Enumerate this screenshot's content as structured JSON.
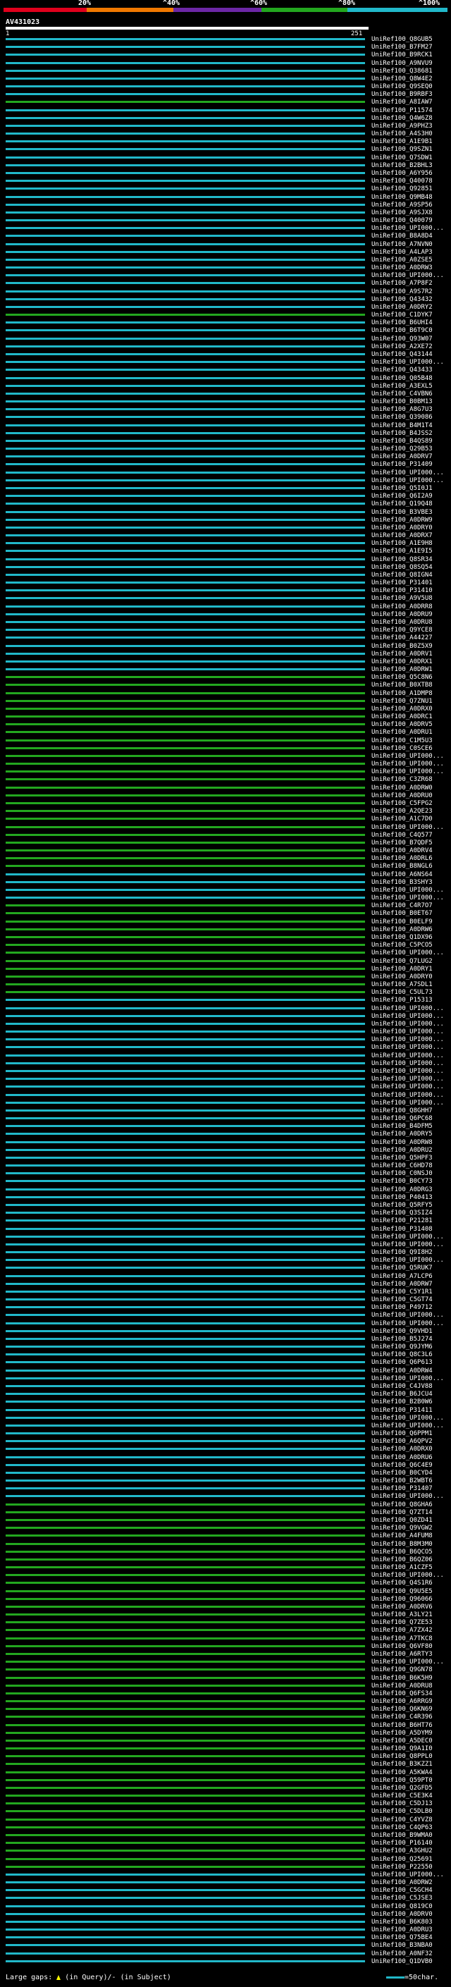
{
  "colors": {
    "background": "#000000",
    "query": "#ffffff",
    "band_0_20": "#e0001c",
    "band_20_40": "#f07800",
    "band_40_60": "#6c27a6",
    "band_60_80": "#23a71f",
    "band_80_100": "#21b8c9",
    "gap_marker": "#ffff00"
  },
  "scale": {
    "labels": [
      "20%",
      "^40%",
      "^60%",
      "^80%",
      "^100%"
    ]
  },
  "query": {
    "name": "AV431023",
    "start": "1",
    "end": "251"
  },
  "footer": {
    "gaps_label": "Large gaps:",
    "in_query": "(in Query)/",
    "in_subject": "- (in Subject)",
    "scale_note": "=50char."
  },
  "hits": [
    {
      "label": "UniRef100_Q8GUB5",
      "color": "cyan"
    },
    {
      "label": "UniRef100_B7FM27",
      "color": "cyan"
    },
    {
      "label": "UniRef100_B9RCK1",
      "color": "cyan"
    },
    {
      "label": "UniRef100_A9NVU9",
      "color": "cyan"
    },
    {
      "label": "UniRef100_Q38681",
      "color": "cyan"
    },
    {
      "label": "UniRef100_Q8W4E2",
      "color": "cyan"
    },
    {
      "label": "UniRef100_Q9SEQ0",
      "color": "cyan"
    },
    {
      "label": "UniRef100_B9RBF3",
      "color": "cyan"
    },
    {
      "label": "UniRef100_A8IAW7",
      "color": "green"
    },
    {
      "label": "UniRef100_P11574",
      "color": "cyan"
    },
    {
      "label": "UniRef100_Q4W6Z8",
      "color": "cyan"
    },
    {
      "label": "UniRef100_A9PHZ3",
      "color": "cyan"
    },
    {
      "label": "UniRef100_A4S3H0",
      "color": "cyan"
    },
    {
      "label": "UniRef100_A1E9B1",
      "color": "cyan"
    },
    {
      "label": "UniRef100_Q9SZN1",
      "color": "cyan"
    },
    {
      "label": "UniRef100_Q7SDW1",
      "color": "cyan"
    },
    {
      "label": "UniRef100_B2BHL3",
      "color": "cyan"
    },
    {
      "label": "UniRef100_A6Y956",
      "color": "cyan"
    },
    {
      "label": "UniRef100_Q40078",
      "color": "cyan"
    },
    {
      "label": "UniRef100_Q92851",
      "color": "cyan"
    },
    {
      "label": "UniRef100_Q9MB48",
      "color": "cyan"
    },
    {
      "label": "UniRef100_A9SP56",
      "color": "cyan"
    },
    {
      "label": "UniRef100_A9SJX8",
      "color": "cyan"
    },
    {
      "label": "UniRef100_Q40079",
      "color": "cyan"
    },
    {
      "label": "UniRef100_UPI000...",
      "color": "cyan"
    },
    {
      "label": "UniRef100_B8A8D4",
      "color": "cyan"
    },
    {
      "label": "UniRef100_A7NVN0",
      "color": "cyan"
    },
    {
      "label": "UniRef100_A4LAP3",
      "color": "cyan"
    },
    {
      "label": "UniRef100_A0ZSE5",
      "color": "cyan"
    },
    {
      "label": "UniRef100_A0DRW3",
      "color": "cyan"
    },
    {
      "label": "UniRef100_UPI000...",
      "color": "cyan"
    },
    {
      "label": "UniRef100_A7P8F2",
      "color": "cyan"
    },
    {
      "label": "UniRef100_A9S7R2",
      "color": "cyan"
    },
    {
      "label": "UniRef100_Q43432",
      "color": "cyan"
    },
    {
      "label": "UniRef100_A0DRY2",
      "color": "cyan"
    },
    {
      "label": "UniRef100_C1DYK7",
      "color": "green"
    },
    {
      "label": "UniRef100_B6UHI4",
      "color": "cyan"
    },
    {
      "label": "UniRef100_B6T9C0",
      "color": "cyan"
    },
    {
      "label": "UniRef100_Q93W07",
      "color": "cyan"
    },
    {
      "label": "UniRef100_A2XE72",
      "color": "cyan"
    },
    {
      "label": "UniRef100_Q43144",
      "color": "cyan"
    },
    {
      "label": "UniRef100_UPI000...",
      "color": "cyan"
    },
    {
      "label": "UniRef100_Q43433",
      "color": "cyan"
    },
    {
      "label": "UniRef100_Q05B48",
      "color": "cyan"
    },
    {
      "label": "UniRef100_A3EXL5",
      "color": "cyan"
    },
    {
      "label": "UniRef100_C4VBN6",
      "color": "cyan"
    },
    {
      "label": "UniRef100_B0BM13",
      "color": "cyan"
    },
    {
      "label": "UniRef100_A8G7U3",
      "color": "cyan"
    },
    {
      "label": "UniRef100_Q39086",
      "color": "cyan"
    },
    {
      "label": "UniRef100_B4M1T4",
      "color": "cyan"
    },
    {
      "label": "UniRef100_B4JSS2",
      "color": "cyan"
    },
    {
      "label": "UniRef100_B4QS89",
      "color": "cyan"
    },
    {
      "label": "UniRef100_Q29B53",
      "color": "cyan"
    },
    {
      "label": "UniRef100_A0DRV7",
      "color": "cyan"
    },
    {
      "label": "UniRef100_P31409",
      "color": "cyan"
    },
    {
      "label": "UniRef100_UPI000...",
      "color": "cyan"
    },
    {
      "label": "UniRef100_UPI000...",
      "color": "cyan"
    },
    {
      "label": "UniRef100_Q5I0J1",
      "color": "cyan"
    },
    {
      "label": "UniRef100_Q6I2A9",
      "color": "cyan"
    },
    {
      "label": "UniRef100_Q19Q48",
      "color": "cyan"
    },
    {
      "label": "UniRef100_B3VBE3",
      "color": "cyan"
    },
    {
      "label": "UniRef100_A0DRW9",
      "color": "cyan"
    },
    {
      "label": "UniRef100_A0DRY0",
      "color": "cyan"
    },
    {
      "label": "UniRef100_A0DRX7",
      "color": "cyan"
    },
    {
      "label": "UniRef100_A1E9H8",
      "color": "cyan"
    },
    {
      "label": "UniRef100_A1E9I5",
      "color": "cyan"
    },
    {
      "label": "UniRef100_Q8SR34",
      "color": "cyan"
    },
    {
      "label": "UniRef100_Q8SQ54",
      "color": "cyan"
    },
    {
      "label": "UniRef100_Q8IGN4",
      "color": "cyan"
    },
    {
      "label": "UniRef100_P31401",
      "color": "cyan"
    },
    {
      "label": "UniRef100_P31410",
      "color": "cyan"
    },
    {
      "label": "UniRef100_A9V5U8",
      "color": "cyan"
    },
    {
      "label": "UniRef100_A0DRR8",
      "color": "cyan"
    },
    {
      "label": "UniRef100_A0DRU9",
      "color": "cyan"
    },
    {
      "label": "UniRef100_A0DRU8",
      "color": "cyan"
    },
    {
      "label": "UniRef100_Q9YCE8",
      "color": "cyan"
    },
    {
      "label": "UniRef100_A44227",
      "color": "cyan"
    },
    {
      "label": "UniRef100_B0Z5X9",
      "color": "cyan"
    },
    {
      "label": "UniRef100_A0DRV1",
      "color": "cyan"
    },
    {
      "label": "UniRef100_A0DRX1",
      "color": "cyan"
    },
    {
      "label": "UniRef100_A0DRW1",
      "color": "cyan"
    },
    {
      "label": "UniRef100_Q5C8N6",
      "color": "green"
    },
    {
      "label": "UniRef100_B0XTB8",
      "color": "green"
    },
    {
      "label": "UniRef100_A1DMP8",
      "color": "green"
    },
    {
      "label": "UniRef100_Q7ZNU1",
      "color": "green"
    },
    {
      "label": "UniRef100_A0DRX0",
      "color": "green"
    },
    {
      "label": "UniRef100_A0DRC1",
      "color": "green"
    },
    {
      "label": "UniRef100_A0DRV5",
      "color": "green"
    },
    {
      "label": "UniRef100_A0DRU1",
      "color": "green"
    },
    {
      "label": "UniRef100_C1M5U3",
      "color": "green"
    },
    {
      "label": "UniRef100_C0SCE6",
      "color": "green"
    },
    {
      "label": "UniRef100_UPI000...",
      "color": "green"
    },
    {
      "label": "UniRef100_UPI000...",
      "color": "green"
    },
    {
      "label": "UniRef100_UPI000...",
      "color": "green"
    },
    {
      "label": "UniRef100_C3ZR68",
      "color": "green"
    },
    {
      "label": "UniRef100_A0DRW0",
      "color": "green"
    },
    {
      "label": "UniRef100_A0DRU0",
      "color": "green"
    },
    {
      "label": "UniRef100_C5FPG2",
      "color": "green"
    },
    {
      "label": "UniRef100_A2QE23",
      "color": "green"
    },
    {
      "label": "UniRef100_A1C7D0",
      "color": "green"
    },
    {
      "label": "UniRef100_UPI000...",
      "color": "green"
    },
    {
      "label": "UniRef100_C4Q577",
      "color": "green"
    },
    {
      "label": "UniRef100_B7QDF5",
      "color": "green"
    },
    {
      "label": "UniRef100_A0DRV4",
      "color": "green"
    },
    {
      "label": "UniRef100_A0DRL6",
      "color": "green"
    },
    {
      "label": "UniRef100_B8NGL6",
      "color": "green"
    },
    {
      "label": "UniRef100_A6NS64",
      "color": "cyan"
    },
    {
      "label": "UniRef100_B3SHY3",
      "color": "cyan"
    },
    {
      "label": "UniRef100_UPI000...",
      "color": "cyan"
    },
    {
      "label": "UniRef100_UPI000...",
      "color": "cyan"
    },
    {
      "label": "UniRef100_C4R7O7",
      "color": "green"
    },
    {
      "label": "UniRef100_B0ET67",
      "color": "green"
    },
    {
      "label": "UniRef100_B0ELF9",
      "color": "green"
    },
    {
      "label": "UniRef100_A0DRW6",
      "color": "green"
    },
    {
      "label": "UniRef100_Q1DX96",
      "color": "green"
    },
    {
      "label": "UniRef100_C5PCO5",
      "color": "green"
    },
    {
      "label": "UniRef100_UPI000...",
      "color": "green"
    },
    {
      "label": "UniRef100_Q7LUG2",
      "color": "green"
    },
    {
      "label": "UniRef100_A0DRY1",
      "color": "green"
    },
    {
      "label": "UniRef100_A0DRY0",
      "color": "green"
    },
    {
      "label": "UniRef100_A7SDL1",
      "color": "green"
    },
    {
      "label": "UniRef100_C5UL73",
      "color": "green"
    },
    {
      "label": "UniRef100_P15313",
      "color": "cyan"
    },
    {
      "label": "UniRef100_UPI000...",
      "color": "cyan"
    },
    {
      "label": "UniRef100_UPI000...",
      "color": "cyan"
    },
    {
      "label": "UniRef100_UPI000...",
      "color": "cyan"
    },
    {
      "label": "UniRef100_UPI000...",
      "color": "cyan"
    },
    {
      "label": "UniRef100_UPI000...",
      "color": "cyan"
    },
    {
      "label": "UniRef100_UPI000...",
      "color": "cyan"
    },
    {
      "label": "UniRef100_UPI000...",
      "color": "cyan"
    },
    {
      "label": "UniRef100_UPI000...",
      "color": "cyan"
    },
    {
      "label": "UniRef100_UPI000...",
      "color": "cyan"
    },
    {
      "label": "UniRef100_UPI000...",
      "color": "cyan"
    },
    {
      "label": "UniRef100_UPI000...",
      "color": "cyan"
    },
    {
      "label": "UniRef100_UPI000...",
      "color": "cyan"
    },
    {
      "label": "UniRef100_UPI000...",
      "color": "cyan"
    },
    {
      "label": "UniRef100_Q8GHH7",
      "color": "cyan"
    },
    {
      "label": "UniRef100_Q6PC68",
      "color": "cyan"
    },
    {
      "label": "UniRef100_B4DFM5",
      "color": "cyan"
    },
    {
      "label": "UniRef100_A0DRY5",
      "color": "cyan"
    },
    {
      "label": "UniRef100_A0DRW8",
      "color": "cyan"
    },
    {
      "label": "UniRef100_A0DRU2",
      "color": "cyan"
    },
    {
      "label": "UniRef100_Q5HPF3",
      "color": "cyan"
    },
    {
      "label": "UniRef100_C6HD78",
      "color": "cyan"
    },
    {
      "label": "UniRef100_C0NSJ0",
      "color": "cyan"
    },
    {
      "label": "UniRef100_B0CY73",
      "color": "cyan"
    },
    {
      "label": "UniRef100_A0DRG3",
      "color": "cyan"
    },
    {
      "label": "UniRef100_P40413",
      "color": "cyan"
    },
    {
      "label": "UniRef100_Q5RFY5",
      "color": "cyan"
    },
    {
      "label": "UniRef100_Q3SIZ4",
      "color": "cyan"
    },
    {
      "label": "UniRef100_P21281",
      "color": "cyan"
    },
    {
      "label": "UniRef100_P31408",
      "color": "cyan"
    },
    {
      "label": "UniRef100_UPI000...",
      "color": "cyan"
    },
    {
      "label": "UniRef100_UPI000...",
      "color": "cyan"
    },
    {
      "label": "UniRef100_Q9I8H2",
      "color": "cyan"
    },
    {
      "label": "UniRef100_UPI000...",
      "color": "cyan"
    },
    {
      "label": "UniRef100_Q5RUK7",
      "color": "cyan"
    },
    {
      "label": "UniRef100_A7LCP6",
      "color": "cyan"
    },
    {
      "label": "UniRef100_A0DRW7",
      "color": "cyan"
    },
    {
      "label": "UniRef100_C5Y1R1",
      "color": "cyan"
    },
    {
      "label": "UniRef100_C5GT74",
      "color": "cyan"
    },
    {
      "label": "UniRef100_P49712",
      "color": "cyan"
    },
    {
      "label": "UniRef100_UPI000...",
      "color": "cyan"
    },
    {
      "label": "UniRef100_UPI000...",
      "color": "cyan"
    },
    {
      "label": "UniRef100_Q9VHD1",
      "color": "cyan"
    },
    {
      "label": "UniRef100_B5J274",
      "color": "cyan"
    },
    {
      "label": "UniRef100_Q9JYM6",
      "color": "cyan"
    },
    {
      "label": "UniRef100_Q8C3L6",
      "color": "cyan"
    },
    {
      "label": "UniRef100_Q6P613",
      "color": "cyan"
    },
    {
      "label": "UniRef100_A0DRW4",
      "color": "cyan"
    },
    {
      "label": "UniRef100_UPI000...",
      "color": "cyan"
    },
    {
      "label": "UniRef100_C4JV88",
      "color": "cyan"
    },
    {
      "label": "UniRef100_B6JCU4",
      "color": "cyan"
    },
    {
      "label": "UniRef100_B2B0W6",
      "color": "cyan"
    },
    {
      "label": "UniRef100_P31411",
      "color": "cyan"
    },
    {
      "label": "UniRef100_UPI000...",
      "color": "cyan"
    },
    {
      "label": "UniRef100_UPI000...",
      "color": "cyan"
    },
    {
      "label": "UniRef100_Q6PPM1",
      "color": "cyan"
    },
    {
      "label": "UniRef100_A6QPV2",
      "color": "cyan"
    },
    {
      "label": "UniRef100_A0DRX0",
      "color": "cyan"
    },
    {
      "label": "UniRef100_A0DRU6",
      "color": "cyan"
    },
    {
      "label": "UniRef100_Q6C4E9",
      "color": "cyan"
    },
    {
      "label": "UniRef100_B0CYD4",
      "color": "cyan"
    },
    {
      "label": "UniRef100_B2WBT6",
      "color": "cyan"
    },
    {
      "label": "UniRef100_P31407",
      "color": "cyan"
    },
    {
      "label": "UniRef100_UPI000...",
      "color": "cyan"
    },
    {
      "label": "UniRef100_Q8GHA6",
      "color": "green"
    },
    {
      "label": "UniRef100_Q7ZT14",
      "color": "green"
    },
    {
      "label": "UniRef100_Q0ZD41",
      "color": "green"
    },
    {
      "label": "UniRef100_Q9VGW2",
      "color": "green"
    },
    {
      "label": "UniRef100_A4FUM8",
      "color": "green"
    },
    {
      "label": "UniRef100_B8M3M0",
      "color": "green"
    },
    {
      "label": "UniRef100_B6QCO5",
      "color": "green"
    },
    {
      "label": "UniRef100_B6QZ06",
      "color": "green"
    },
    {
      "label": "UniRef100_A1CZF5",
      "color": "green"
    },
    {
      "label": "UniRef100_UPI000...",
      "color": "green"
    },
    {
      "label": "UniRef100_Q4S1R6",
      "color": "green"
    },
    {
      "label": "UniRef100_Q9U5E5",
      "color": "green"
    },
    {
      "label": "UniRef100_Q96066",
      "color": "green"
    },
    {
      "label": "UniRef100_A0DRV6",
      "color": "green"
    },
    {
      "label": "UniRef100_A3LY21",
      "color": "green"
    },
    {
      "label": "UniRef100_Q7ZE53",
      "color": "green"
    },
    {
      "label": "UniRef100_A7ZX42",
      "color": "green"
    },
    {
      "label": "UniRef100_A7TKC8",
      "color": "green"
    },
    {
      "label": "UniRef100_Q6VF80",
      "color": "green"
    },
    {
      "label": "UniRef100_A6RTY3",
      "color": "green"
    },
    {
      "label": "UniRef100_UPI000...",
      "color": "green"
    },
    {
      "label": "UniRef100_Q9GN78",
      "color": "green"
    },
    {
      "label": "UniRef100_B6K5H9",
      "color": "green"
    },
    {
      "label": "UniRef100_A0DRU8",
      "color": "green"
    },
    {
      "label": "UniRef100_Q6FS34",
      "color": "green"
    },
    {
      "label": "UniRef100_A6RRG9",
      "color": "green"
    },
    {
      "label": "UniRef100_Q6KN69",
      "color": "green"
    },
    {
      "label": "UniRef100_C4R396",
      "color": "green"
    },
    {
      "label": "UniRef100_B6HT76",
      "color": "green"
    },
    {
      "label": "UniRef100_A5DYM9",
      "color": "green"
    },
    {
      "label": "UniRef100_A5DEC0",
      "color": "green"
    },
    {
      "label": "UniRef100_Q9A1I0",
      "color": "green"
    },
    {
      "label": "UniRef100_Q8PPL0",
      "color": "green"
    },
    {
      "label": "UniRef100_B3KZZ1",
      "color": "green"
    },
    {
      "label": "UniRef100_A5KWA4",
      "color": "green"
    },
    {
      "label": "UniRef100_Q59PT0",
      "color": "green"
    },
    {
      "label": "UniRef100_Q2GFD5",
      "color": "green"
    },
    {
      "label": "UniRef100_C5E3K4",
      "color": "green"
    },
    {
      "label": "UniRef100_C5DJ13",
      "color": "green"
    },
    {
      "label": "UniRef100_C5DLB0",
      "color": "green"
    },
    {
      "label": "UniRef100_C4YVZ8",
      "color": "green"
    },
    {
      "label": "UniRef100_C4QP63",
      "color": "green"
    },
    {
      "label": "UniRef100_B9WMA0",
      "color": "green"
    },
    {
      "label": "UniRef100_P16140",
      "color": "green"
    },
    {
      "label": "UniRef100_A3GHU2",
      "color": "green"
    },
    {
      "label": "UniRef100_Q25691",
      "color": "green"
    },
    {
      "label": "UniRef100_P22550",
      "color": "green"
    },
    {
      "label": "UniRef100_UPI000...",
      "color": "cyan"
    },
    {
      "label": "UniRef100_A0DRW2",
      "color": "cyan"
    },
    {
      "label": "UniRef100_C5GCH4",
      "color": "cyan"
    },
    {
      "label": "UniRef100_C5JSE3",
      "color": "cyan"
    },
    {
      "label": "UniRef100_Q819C0",
      "color": "cyan"
    },
    {
      "label": "UniRef100_A0DRV0",
      "color": "cyan"
    },
    {
      "label": "UniRef100_B6K803",
      "color": "cyan"
    },
    {
      "label": "UniRef100_A0DRU3",
      "color": "cyan"
    },
    {
      "label": "UniRef100_Q75BE4",
      "color": "cyan"
    },
    {
      "label": "UniRef100_B3NBA0",
      "color": "cyan"
    },
    {
      "label": "UniRef100_A0NF32",
      "color": "cyan"
    },
    {
      "label": "UniRef100_Q1DVB0",
      "color": "cyan"
    }
  ]
}
